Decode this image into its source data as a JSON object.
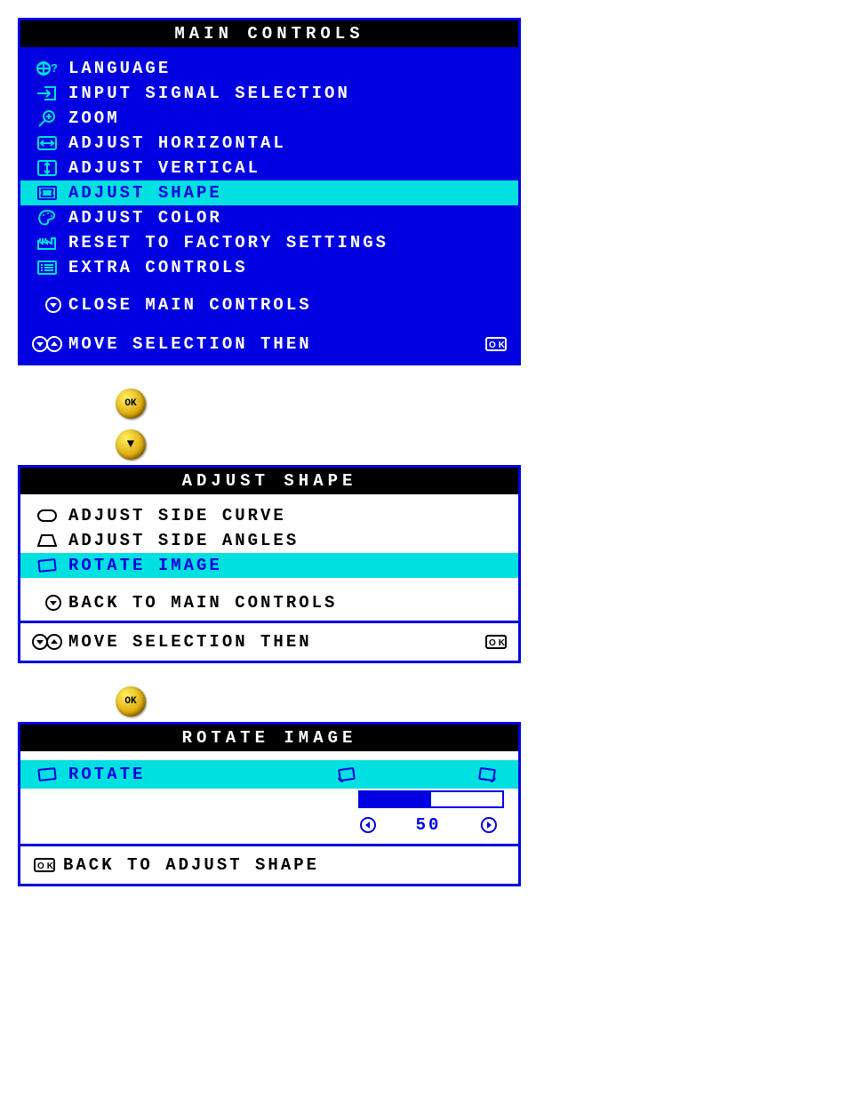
{
  "main_controls": {
    "title": "MAIN CONTROLS",
    "items": [
      {
        "label": "LANGUAGE",
        "icon": "globe-question"
      },
      {
        "label": "INPUT SIGNAL SELECTION",
        "icon": "input-arrow"
      },
      {
        "label": "ZOOM",
        "icon": "magnifier-plus"
      },
      {
        "label": "ADJUST HORIZONTAL",
        "icon": "arrows-h-box"
      },
      {
        "label": "ADJUST VERTICAL",
        "icon": "arrows-v-box"
      },
      {
        "label": "ADJUST SHAPE",
        "icon": "shape-box",
        "selected": true
      },
      {
        "label": "ADJUST COLOR",
        "icon": "palette"
      },
      {
        "label": "RESET TO FACTORY SETTINGS",
        "icon": "factory"
      },
      {
        "label": "EXTRA CONTROLS",
        "icon": "list-box"
      }
    ],
    "close_label": "CLOSE MAIN CONTROLS",
    "footer_label": "MOVE SELECTION THEN"
  },
  "knob_ok": "OK",
  "knob_down": "▼",
  "adjust_shape": {
    "title": "ADJUST SHAPE",
    "items": [
      {
        "label": "ADJUST SIDE CURVE",
        "icon": "oval"
      },
      {
        "label": "ADJUST SIDE ANGLES",
        "icon": "trapezoid"
      },
      {
        "label": "ROTATE IMAGE",
        "icon": "tilt-box",
        "selected": true
      }
    ],
    "back_label": "BACK TO MAIN CONTROLS",
    "footer_label": "MOVE SELECTION THEN"
  },
  "rotate_image": {
    "title": "ROTATE IMAGE",
    "item_label": "ROTATE",
    "value": "50",
    "fill_percent": 50,
    "footer_label": "BACK TO ADJUST SHAPE"
  }
}
